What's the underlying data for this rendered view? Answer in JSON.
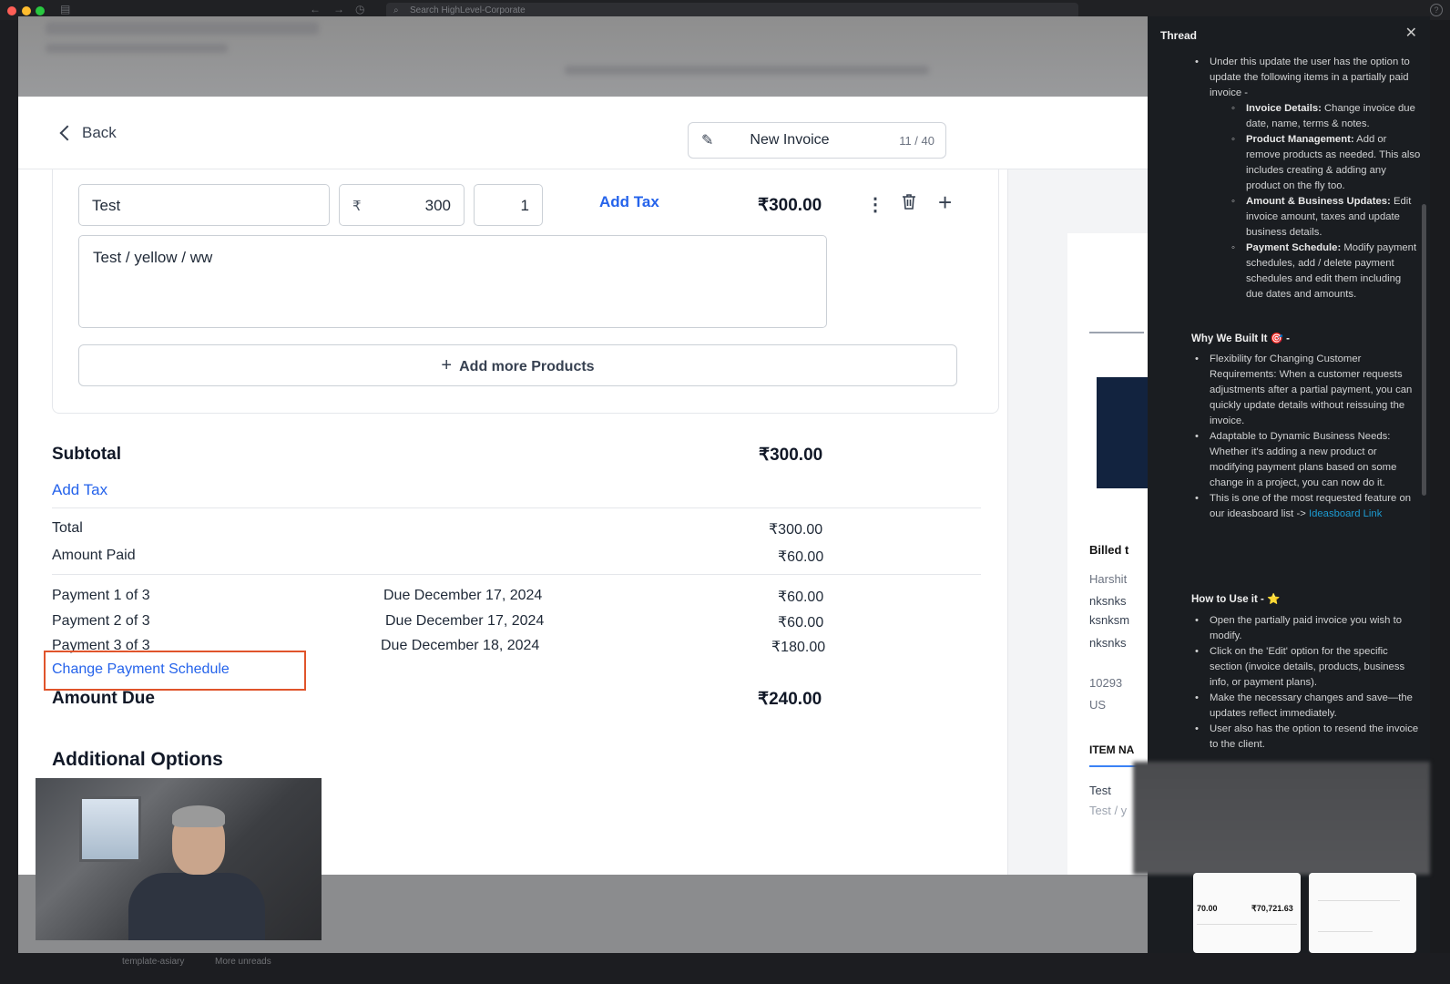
{
  "mac": {
    "search_placeholder": "Search HighLevel-Corporate"
  },
  "topbar": {
    "back_label": "Back",
    "invoice_name": "New Invoice",
    "char_count": "11 / 40"
  },
  "line_item": {
    "name": "Test",
    "currency": "₹",
    "price": "300",
    "qty": "1",
    "add_tax": "Add Tax",
    "total": "₹300.00",
    "description": "Test / yellow / ww"
  },
  "add_more_label": "Add more Products",
  "summary": {
    "subtotal_label": "Subtotal",
    "subtotal": "₹300.00",
    "add_tax": "Add Tax",
    "total_label": "Total",
    "total": "₹300.00",
    "paid_label": "Amount Paid",
    "paid": "₹60.00",
    "payments": [
      {
        "label": "Payment 1 of 3",
        "due": "Due December 17, 2024",
        "amount": "₹60.00"
      },
      {
        "label": "Payment 2 of 3",
        "due": "Due December 17, 2024",
        "amount": "₹60.00"
      },
      {
        "label": "Payment 3 of 3",
        "due": "Due December 18, 2024",
        "amount": "₹180.00"
      }
    ],
    "change_schedule": "Change Payment Schedule",
    "due_label": "Amount Due",
    "due": "₹240.00",
    "additional": "Additional Options"
  },
  "preview": {
    "billed_to": "Billed t",
    "l1": "Harshit",
    "l2": "nksnks",
    "l3": "ksnksm",
    "l4": "nksnks",
    "l5": "10293",
    "l6": "US",
    "item_hdr": "ITEM NA",
    "item": "Test",
    "item_sub": "Test / y"
  },
  "thread": {
    "title": "Thread",
    "intro": "Under this update the user has the option to update the following items in a partially paid invoice -",
    "items": [
      {
        "b": "Invoice Details:",
        "t": " Change invoice due date, name, terms & notes."
      },
      {
        "b": "Product Management:",
        "t": " Add or remove products as needed. This also includes creating & adding any product on the fly too."
      },
      {
        "b": "Amount & Business Updates:",
        "t": " Edit invoice amount, taxes and update business details."
      },
      {
        "b": "Payment Schedule:",
        "t": " Modify payment schedules, add / delete payment schedules and edit them including due dates and amounts."
      }
    ],
    "why_heading": "Why We Built It 🎯 -",
    "why": [
      "Flexibility for Changing Customer Requirements: When a customer requests adjustments after a partial payment, you can quickly update details without reissuing the invoice.",
      "Adaptable to Dynamic Business Needs: Whether it's adding a new product or modifying payment plans based on some change in a project, you can now do it."
    ],
    "why_last": "This is one of the most requested feature on our ideasboard list -> ",
    "why_link": "Ideasboard Link",
    "how_heading": "How to Use it - ⭐",
    "how": [
      "Open the partially paid invoice you wish to modify.",
      "Click on the 'Edit' option for the specific section (invoice details, products, business info, or payment plans).",
      "Make the necessary changes and save—the updates reflect immediately.",
      "User also has the option to resend the invoice to the client."
    ],
    "thumb1_a": "70.00",
    "thumb1_b": "₹70,721.63"
  },
  "bottom": {
    "left_text": "template-asiary",
    "more_unreads": "More unreads"
  }
}
